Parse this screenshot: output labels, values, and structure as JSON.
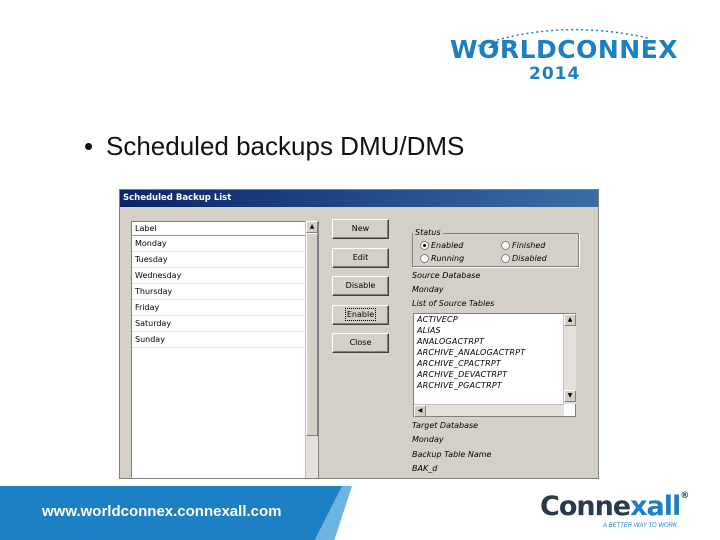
{
  "logo": {
    "name": "WORLDCONNEX",
    "year": "2014"
  },
  "slide": {
    "bullet": "Scheduled backups DMU/DMS"
  },
  "dialog": {
    "title": "Scheduled Backup List",
    "list": {
      "header": "Label",
      "items": [
        "Monday",
        "Tuesday",
        "Wednesday",
        "Thursday",
        "Friday",
        "Saturday",
        "Sunday"
      ]
    },
    "buttons": {
      "new": "New",
      "edit": "Edit",
      "disable": "Disable",
      "enable": "Enable",
      "close": "Close"
    },
    "status": {
      "title": "Status",
      "options": [
        "Enabled",
        "Finished",
        "Running",
        "Disabled"
      ],
      "selected": "Enabled"
    },
    "source_database": {
      "label": "Source Database",
      "value": "Monday"
    },
    "source_tables": {
      "label": "List of Source Tables",
      "items": [
        "ACTIVECP",
        "ALIAS",
        "ANALOGACTRPT",
        "ARCHIVE_ANALOGACTRPT",
        "ARCHIVE_CPACTRPT",
        "ARCHIVE_DEVACTRPT",
        "ARCHIVE_PGACTRPT"
      ]
    },
    "target_database": {
      "label": "Target Database",
      "value": "Monday"
    },
    "backup_table": {
      "label": "Backup Table Name",
      "value": "BAK_d"
    }
  },
  "footer": {
    "url": "www.worldconnex.connexall.com",
    "brand_main": "Conne",
    "brand_accent": "xall",
    "brand_reg": "®",
    "tagline": "A BETTER WAY TO WORK"
  },
  "colors": {
    "brand_blue": "#1d7fc4",
    "title_bar": "#0a246a",
    "dialog_face": "#d4d0c8"
  }
}
